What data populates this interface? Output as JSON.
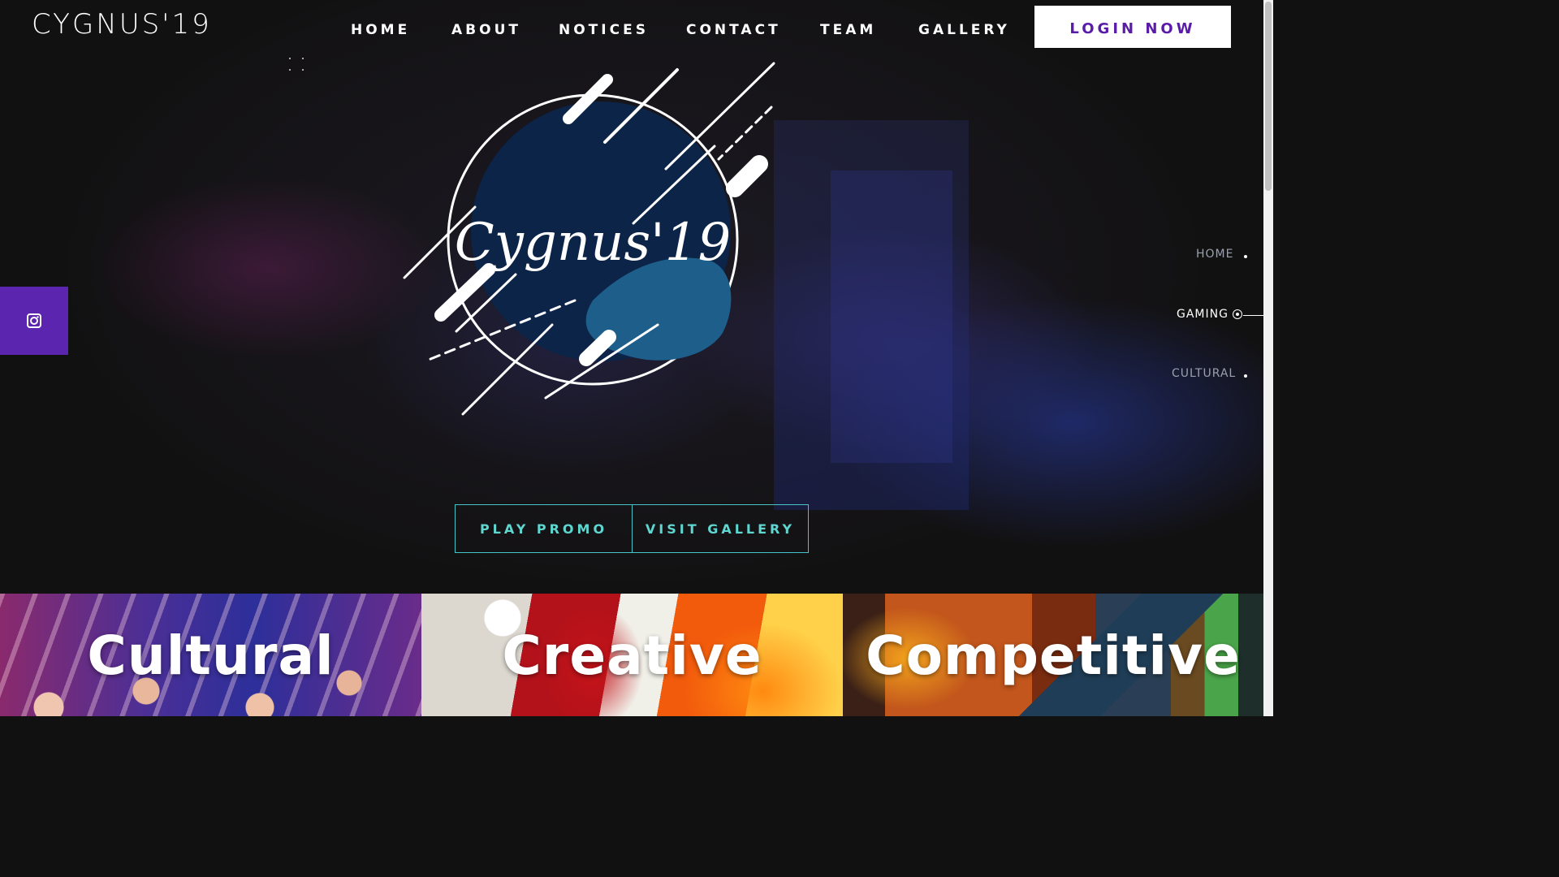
{
  "brand": {
    "title": "CYGNUS'19"
  },
  "nav": {
    "items": [
      {
        "label": "HOME"
      },
      {
        "label": "ABOUT"
      },
      {
        "label": "NOTICES"
      },
      {
        "label": "CONTACT"
      },
      {
        "label": "TEAM"
      },
      {
        "label": "GALLERY"
      }
    ],
    "login_label": "LOGIN NOW"
  },
  "hero": {
    "logo_text": "Cygnus'19",
    "buttons": [
      {
        "label": "PLAY PROMO"
      },
      {
        "label": "VISIT GALLERY"
      }
    ]
  },
  "side_nav": {
    "items": [
      {
        "label": "HOME",
        "active": false
      },
      {
        "label": "GAMING",
        "active": true
      },
      {
        "label": "CULTURAL",
        "active": false
      }
    ]
  },
  "social": {
    "icon": "instagram-icon",
    "color": "#5b25b0"
  },
  "panels": [
    {
      "title": "Cultural"
    },
    {
      "title": "Creative"
    },
    {
      "title": "Competitive"
    }
  ],
  "colors": {
    "accent_purple": "#5b25b0",
    "login_text": "#5a1ca8",
    "cta_teal": "#5fd6cf",
    "logo_circle": "#0b2447"
  }
}
